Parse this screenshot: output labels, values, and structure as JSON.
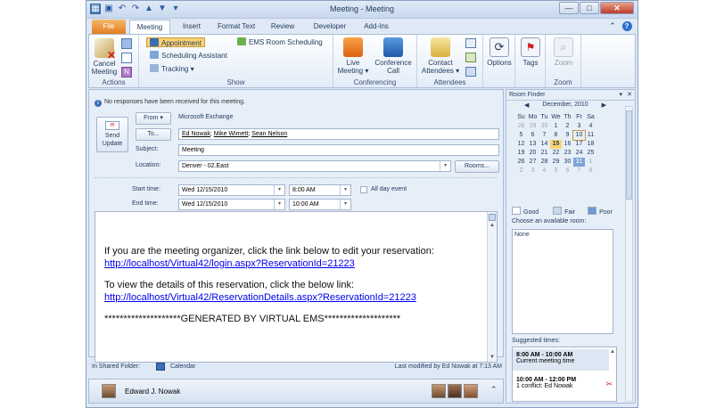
{
  "window": {
    "title": "Meeting - Meeting",
    "minimize": "—",
    "maximize": "□",
    "close": "✕"
  },
  "qat_icons": [
    "save-icon",
    "undo-icon",
    "redo-icon",
    "up-arrow-icon",
    "down-arrow-icon",
    "customize-qat-icon"
  ],
  "tabs": [
    "File",
    "Meeting",
    "Insert",
    "Format Text",
    "Review",
    "Developer",
    "Add-Ins"
  ],
  "ribbon": {
    "actions": {
      "label": "Actions",
      "cancel": "Cancel Meeting"
    },
    "show": {
      "label": "Show",
      "appointment": "Appointment",
      "scheduling": "Scheduling Assistant",
      "tracking": "Tracking ▾",
      "ems": "EMS Room Scheduling"
    },
    "conferencing": {
      "label": "Conferencing",
      "live": "Live Meeting ▾",
      "conf_call": "Conference Call"
    },
    "attendees": {
      "label": "Attendees",
      "contact": "Contact Attendees ▾"
    },
    "options": {
      "label": "Options"
    },
    "tags": {
      "label": "Tags"
    },
    "zoom": {
      "label": "Zoom",
      "zoom_btn": "Zoom"
    }
  },
  "form": {
    "info": "No responses have been received for this meeting.",
    "send_update": "Send Update",
    "from_btn": "From ▾",
    "from_value": "Microsoft Exchange",
    "to_btn": "To...",
    "to_value": [
      "Ed Nowak",
      "Mike Wimett",
      "Sean Nelson"
    ],
    "subject_label": "Subject:",
    "subject_value": "Meeting",
    "location_label": "Location:",
    "location_value": "Denver - 02.East",
    "rooms_btn": "Rooms...",
    "start_label": "Start time:",
    "start_date": "Wed 12/15/2010",
    "start_time": "8:00 AM",
    "all_day": "All day event",
    "end_label": "End time:",
    "end_date": "Wed 12/15/2010",
    "end_time": "10:00 AM"
  },
  "body": {
    "line1": "If you are the meeting organizer, click the link below to edit your reservation:",
    "link1": "http://localhost/Virtual42/login.aspx?ReservationId=21223",
    "line2": "To view the details of this reservation, click the below link:",
    "link2": "http://localhost/Virtual42/ReservationDetails.aspx?ReservationId=21223",
    "footer": "********************GENERATED BY VIRTUAL EMS********************"
  },
  "status": {
    "folder_label": "In Shared Folder:",
    "folder": "Calendar",
    "modified": "Last modified by Ed Nowak at 7:13 AM"
  },
  "people": {
    "name": "Edward J. Nowak"
  },
  "room_finder": {
    "title": "Room Finder",
    "month": "December, 2010",
    "weekdays": [
      "Su",
      "Mo",
      "Tu",
      "We",
      "Th",
      "Fr",
      "Sa"
    ],
    "weeks": [
      [
        "28",
        "29",
        "30",
        "1",
        "2",
        "3",
        "4"
      ],
      [
        "5",
        "6",
        "7",
        "8",
        "9",
        "10",
        "11"
      ],
      [
        "12",
        "13",
        "14",
        "15",
        "16",
        "17",
        "18"
      ],
      [
        "19",
        "20",
        "21",
        "22",
        "23",
        "24",
        "25"
      ],
      [
        "26",
        "27",
        "28",
        "29",
        "30",
        "31",
        "1"
      ],
      [
        "2",
        "3",
        "4",
        "5",
        "6",
        "7",
        "8"
      ]
    ],
    "legend": {
      "good": "Good",
      "fair": "Fair",
      "poor": "Poor"
    },
    "choose_label": "Choose an available room:",
    "rooms_value": "None",
    "suggested_label": "Suggested times:",
    "suggestions": [
      {
        "time": "8:00 AM - 10:00 AM",
        "note": "Current meeting time"
      },
      {
        "time": "10:00 AM - 12:00 PM",
        "note": "1 conflict: Ed Nowak"
      }
    ]
  },
  "colors": {
    "accent": "#2a5aa0",
    "file_tab": "#e37d20",
    "link": "#0000ee",
    "today": "#fcd372",
    "selected_week": "#7ea4d8"
  }
}
